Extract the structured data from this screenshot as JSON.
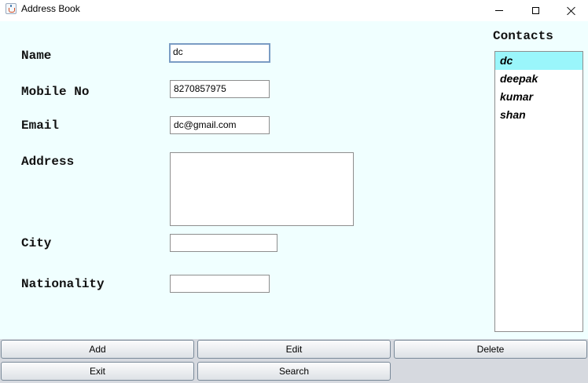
{
  "window": {
    "title": "Address Book"
  },
  "form": {
    "name_label": "Name",
    "mobile_label": "Mobile No",
    "email_label": "Email",
    "address_label": "Address",
    "city_label": "City",
    "nationality_label": "Nationality",
    "name_value": "dc",
    "mobile_value": "8270857975",
    "email_value": "dc@gmail.com",
    "address_value": "",
    "city_value": "",
    "nationality_value": ""
  },
  "contacts": {
    "title": "Contacts",
    "items": [
      "dc",
      "deepak",
      "kumar",
      "shan"
    ],
    "selected": "dc"
  },
  "buttons": {
    "add": "Add",
    "edit": "Edit",
    "delete": "Delete",
    "exit": "Exit",
    "search": "Search"
  },
  "colors": {
    "content_bg": "#f0ffff",
    "selection": "#9af6fb",
    "button_area_bg": "#d6d9df"
  },
  "icons": [
    "java-app-icon",
    "minimize-icon",
    "maximize-icon",
    "close-icon"
  ]
}
